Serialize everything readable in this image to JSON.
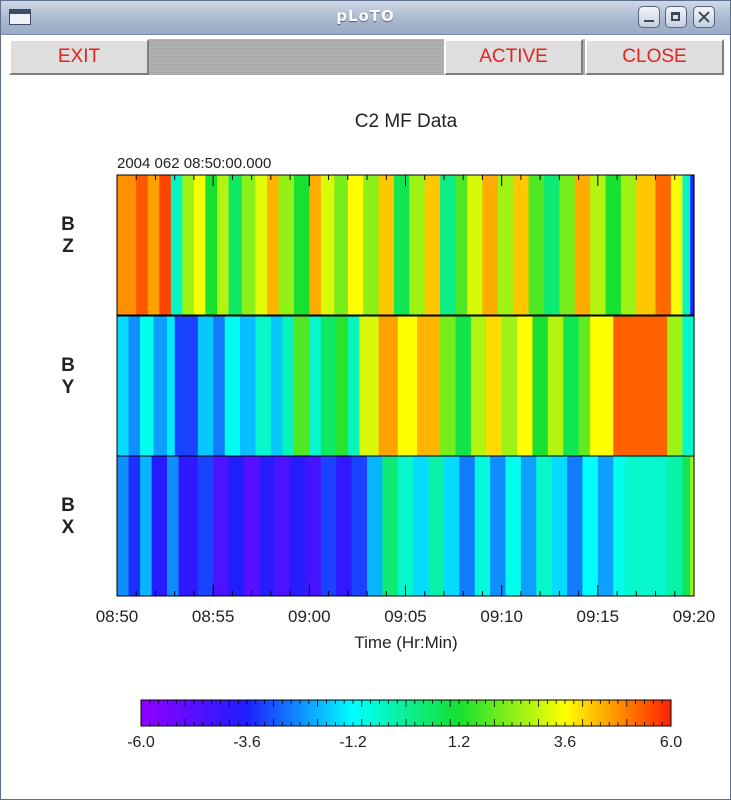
{
  "window": {
    "title": "pLoTO"
  },
  "toolbar": {
    "exit_label": "EXIT",
    "active_label": "ACTIVE",
    "close_label": "CLOSE"
  },
  "plot": {
    "title": "C2 MF Data",
    "timestamp": "2004 062 08:50:00.000",
    "xlabel": "Time (Hr:Min)"
  },
  "chart_data": {
    "type": "heatmap",
    "title": "C2 MF Data",
    "xlabel": "Time (Hr:Min)",
    "x_ticks": [
      "08:50",
      "08:55",
      "09:00",
      "09:05",
      "09:10",
      "09:15",
      "09:20"
    ],
    "x_range_minutes": [
      0,
      30
    ],
    "rows": [
      {
        "name": "B Z",
        "label_lines": [
          "B",
          "Z"
        ],
        "segments": [
          [
            0,
            4.8
          ],
          [
            1,
            5.4
          ],
          [
            1.6,
            4.6
          ],
          [
            2.2,
            5.6
          ],
          [
            2.8,
            -0.5
          ],
          [
            3.4,
            2.6
          ],
          [
            4,
            3.5
          ],
          [
            4.6,
            1.2
          ],
          [
            5.2,
            2.8
          ],
          [
            5.8,
            0.6
          ],
          [
            6.5,
            2.4
          ],
          [
            7.2,
            3.3
          ],
          [
            7.8,
            4.4
          ],
          [
            8.4,
            2.5
          ],
          [
            9.2,
            1.2
          ],
          [
            10,
            4.5
          ],
          [
            10.6,
            3.2
          ],
          [
            11.3,
            2.2
          ],
          [
            12,
            3.6
          ],
          [
            12.8,
            2.4
          ],
          [
            13.6,
            4.2
          ],
          [
            14.4,
            0.8
          ],
          [
            15.2,
            2.6
          ],
          [
            16,
            4.2
          ],
          [
            16.8,
            0.2
          ],
          [
            17.6,
            1.8
          ],
          [
            18.2,
            3.2
          ],
          [
            19,
            4.5
          ],
          [
            19.8,
            2.6
          ],
          [
            20.6,
            4.2
          ],
          [
            21.4,
            1.8
          ],
          [
            22.2,
            0.4
          ],
          [
            23,
            2.2
          ],
          [
            23.8,
            4.5
          ],
          [
            24.6,
            2.8
          ],
          [
            25.4,
            1.2
          ],
          [
            26.2,
            2.6
          ],
          [
            27,
            4.2
          ],
          [
            28,
            5.2
          ],
          [
            28.8,
            3.5
          ],
          [
            29.4,
            -0.5
          ],
          [
            29.8,
            -3.5
          ]
        ]
      },
      {
        "name": "B Y",
        "label_lines": [
          "B",
          "Y"
        ],
        "segments": [
          [
            0,
            -1.6
          ],
          [
            0.6,
            -2.4
          ],
          [
            1.2,
            -1.0
          ],
          [
            1.9,
            -2.2
          ],
          [
            2.6,
            -1.4
          ],
          [
            3,
            -3.2
          ],
          [
            4.2,
            -1.8
          ],
          [
            5,
            -2.6
          ],
          [
            5.6,
            -1.0
          ],
          [
            6.4,
            -1.9
          ],
          [
            7.2,
            -0.6
          ],
          [
            8,
            -1.8
          ],
          [
            8.6,
            -0.4
          ],
          [
            9.2,
            1.8
          ],
          [
            10,
            -0.6
          ],
          [
            10.6,
            0.6
          ],
          [
            11.4,
            1.4
          ],
          [
            12,
            -0.4
          ],
          [
            12.6,
            3.2
          ],
          [
            13.6,
            4.6
          ],
          [
            14.6,
            3.6
          ],
          [
            15.6,
            4.4
          ],
          [
            16.8,
            2.2
          ],
          [
            17.6,
            0.9
          ],
          [
            18.4,
            2.8
          ],
          [
            19.2,
            4.0
          ],
          [
            20,
            2.6
          ],
          [
            20.8,
            3.6
          ],
          [
            21.6,
            1.2
          ],
          [
            22.4,
            2.8
          ],
          [
            23.2,
            0.8
          ],
          [
            24,
            2.0
          ],
          [
            24.6,
            3.6
          ],
          [
            25.8,
            5.3
          ],
          [
            28.6,
            2.6
          ],
          [
            29.4,
            -0.6
          ]
        ]
      },
      {
        "name": "B X",
        "label_lines": [
          "B",
          "X"
        ],
        "segments": [
          [
            0,
            -2.4
          ],
          [
            0.6,
            -3.4
          ],
          [
            1.2,
            -2.0
          ],
          [
            1.8,
            -3.8
          ],
          [
            2.6,
            -2.4
          ],
          [
            3.2,
            -4.0
          ],
          [
            4.2,
            -3.2
          ],
          [
            5,
            -4.6
          ],
          [
            5.8,
            -3.6
          ],
          [
            6.6,
            -4.8
          ],
          [
            7.4,
            -3.8
          ],
          [
            8.2,
            -4.6
          ],
          [
            9,
            -3.8
          ],
          [
            9.8,
            -4.4
          ],
          [
            10.6,
            -3.2
          ],
          [
            11.4,
            -4.0
          ],
          [
            12.2,
            -3.2
          ],
          [
            13,
            -2.0
          ],
          [
            13.8,
            0.4
          ],
          [
            14.6,
            -0.6
          ],
          [
            15.4,
            -1.6
          ],
          [
            16.2,
            -0.2
          ],
          [
            17,
            -1.6
          ],
          [
            17.8,
            -2.6
          ],
          [
            18.6,
            -0.8
          ],
          [
            19.4,
            -2.4
          ],
          [
            20.2,
            -1.0
          ],
          [
            21,
            -2.2
          ],
          [
            21.8,
            -0.6
          ],
          [
            22.6,
            -1.6
          ],
          [
            23.4,
            -2.6
          ],
          [
            24.2,
            -1.2
          ],
          [
            25,
            -2.2
          ],
          [
            25.8,
            -1.0
          ],
          [
            26.4,
            -0.6
          ],
          [
            28.6,
            -0.2
          ],
          [
            29.4,
            0.8
          ],
          [
            29.8,
            2.6
          ]
        ]
      }
    ],
    "colorbar": {
      "min": -6.0,
      "max": 6.0,
      "tick_labels": [
        "-6.0",
        "-3.6",
        "-1.2",
        "1.2",
        "3.6",
        "6.0"
      ]
    }
  }
}
